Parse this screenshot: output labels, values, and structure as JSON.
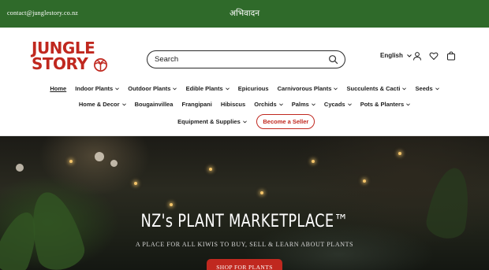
{
  "topbar": {
    "email": "contact@junglestory.co.nz",
    "greeting": "अभिवादन"
  },
  "header": {
    "logo_line1": "JUNGLE",
    "logo_line2": "STORY",
    "search": {
      "placeholder": "Search"
    },
    "language": "English",
    "icons": [
      "search-icon",
      "user-icon",
      "heart-icon",
      "bag-icon"
    ]
  },
  "nav": {
    "row1": [
      {
        "label": "Home",
        "dropdown": false
      },
      {
        "label": "Indoor Plants",
        "dropdown": true
      },
      {
        "label": "Outdoor Plants",
        "dropdown": true
      },
      {
        "label": "Edible Plants",
        "dropdown": true
      },
      {
        "label": "Epicurious",
        "dropdown": false
      },
      {
        "label": "Carnivorous Plants",
        "dropdown": true
      },
      {
        "label": "Succulents & Cacti",
        "dropdown": true
      },
      {
        "label": "Seeds",
        "dropdown": true
      }
    ],
    "row2": [
      {
        "label": "Home & Decor",
        "dropdown": true
      },
      {
        "label": "Bougainvillea",
        "dropdown": false
      },
      {
        "label": "Frangipani",
        "dropdown": false
      },
      {
        "label": "Hibiscus",
        "dropdown": false
      },
      {
        "label": "Orchids",
        "dropdown": true
      },
      {
        "label": "Palms",
        "dropdown": true
      },
      {
        "label": "Cycads",
        "dropdown": true
      },
      {
        "label": "Pots & Planters",
        "dropdown": true
      }
    ],
    "row3": [
      {
        "label": "Equipment & Supplies",
        "dropdown": true
      }
    ],
    "seller_button": "Become a Seller"
  },
  "hero": {
    "title": "NZ's PLANT MARKETPLACE™",
    "subtitle": "A PLACE FOR ALL KIWIS TO BUY, SELL & LEARN ABOUT PLANTS",
    "cta": "SHOP FOR PLANTS"
  },
  "colors": {
    "topbar": "#2f6a2a",
    "brand_red": "#c0281f",
    "text": "#1d1d1d"
  }
}
